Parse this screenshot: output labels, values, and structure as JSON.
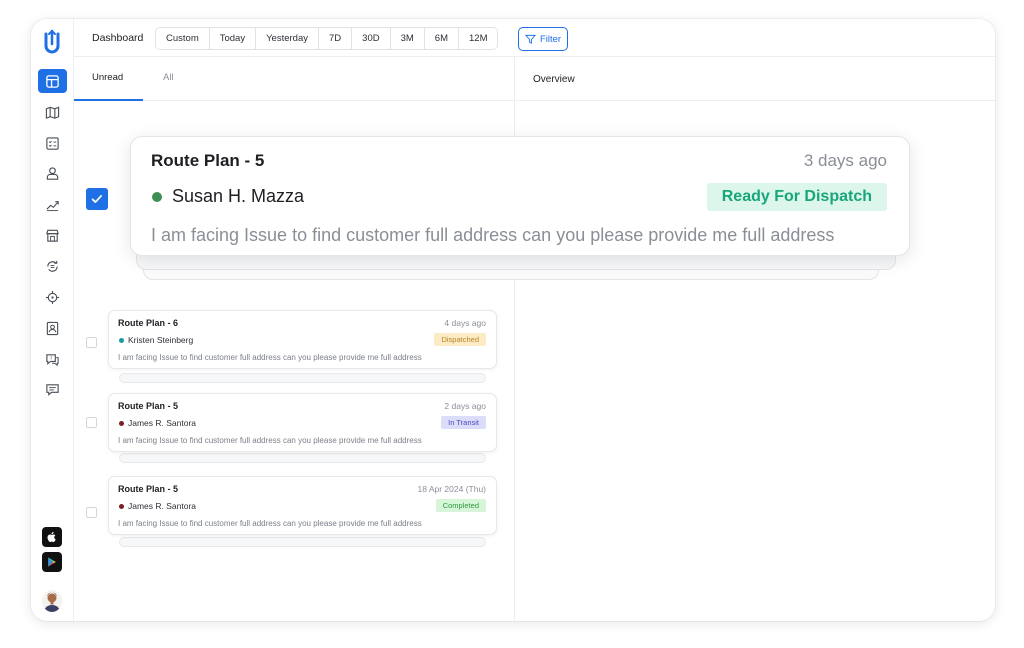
{
  "topbar": {
    "title": "Dashboard",
    "ranges": [
      "Custom",
      "Today",
      "Yesterday",
      "7D",
      "30D",
      "3M",
      "6M",
      "12M"
    ],
    "filter_label": "Filter"
  },
  "tabs": {
    "unread": "Unread",
    "all": "All"
  },
  "overview": {
    "title": "Overview"
  },
  "featured": {
    "title": "Route Plan - 5",
    "time": "3 days ago",
    "name": "Susan H. Mazza",
    "status": "Ready For Dispatch",
    "message": "I am facing Issue to find customer full address can you please provide me full address",
    "dot_color": "#3f8f55"
  },
  "cards": [
    {
      "title": "Route Plan - 6",
      "time": "4 days ago",
      "name": "Kristen Steinberg",
      "status": "Dispatched",
      "message": "I am facing Issue to find customer full address can you please provide me full address",
      "dot_color": "#1a9aa0",
      "badge_bg": "#fdebc6",
      "badge_fg": "#b7862a"
    },
    {
      "title": "Route Plan - 5",
      "time": "2 days ago",
      "name": "James R. Santora",
      "status": "In Transit",
      "message": "I am facing Issue to find customer full address can you please provide me full address",
      "dot_color": "#7a1f24",
      "badge_bg": "#dcdcfb",
      "badge_fg": "#4b4bb8"
    },
    {
      "title": "Route Plan - 5",
      "time": "18 Apr 2024 (Thu)",
      "name": "James R. Santora",
      "status": "Completed",
      "message": "I am facing Issue to find customer full address can you please provide me full address",
      "dot_color": "#7a1f24",
      "badge_bg": "#d7f6d9",
      "badge_fg": "#2f9a3e"
    }
  ],
  "sidebar": {
    "icons": [
      "dashboard-icon",
      "map-icon",
      "checklist-icon",
      "driver-icon",
      "analytics-icon",
      "store-icon",
      "exchange-icon",
      "location-target-icon",
      "contacts-icon",
      "help-chat-icon",
      "message-icon"
    ],
    "store_icons": [
      "apple-store-icon",
      "google-play-icon"
    ],
    "accent": "#1f6fe5"
  }
}
